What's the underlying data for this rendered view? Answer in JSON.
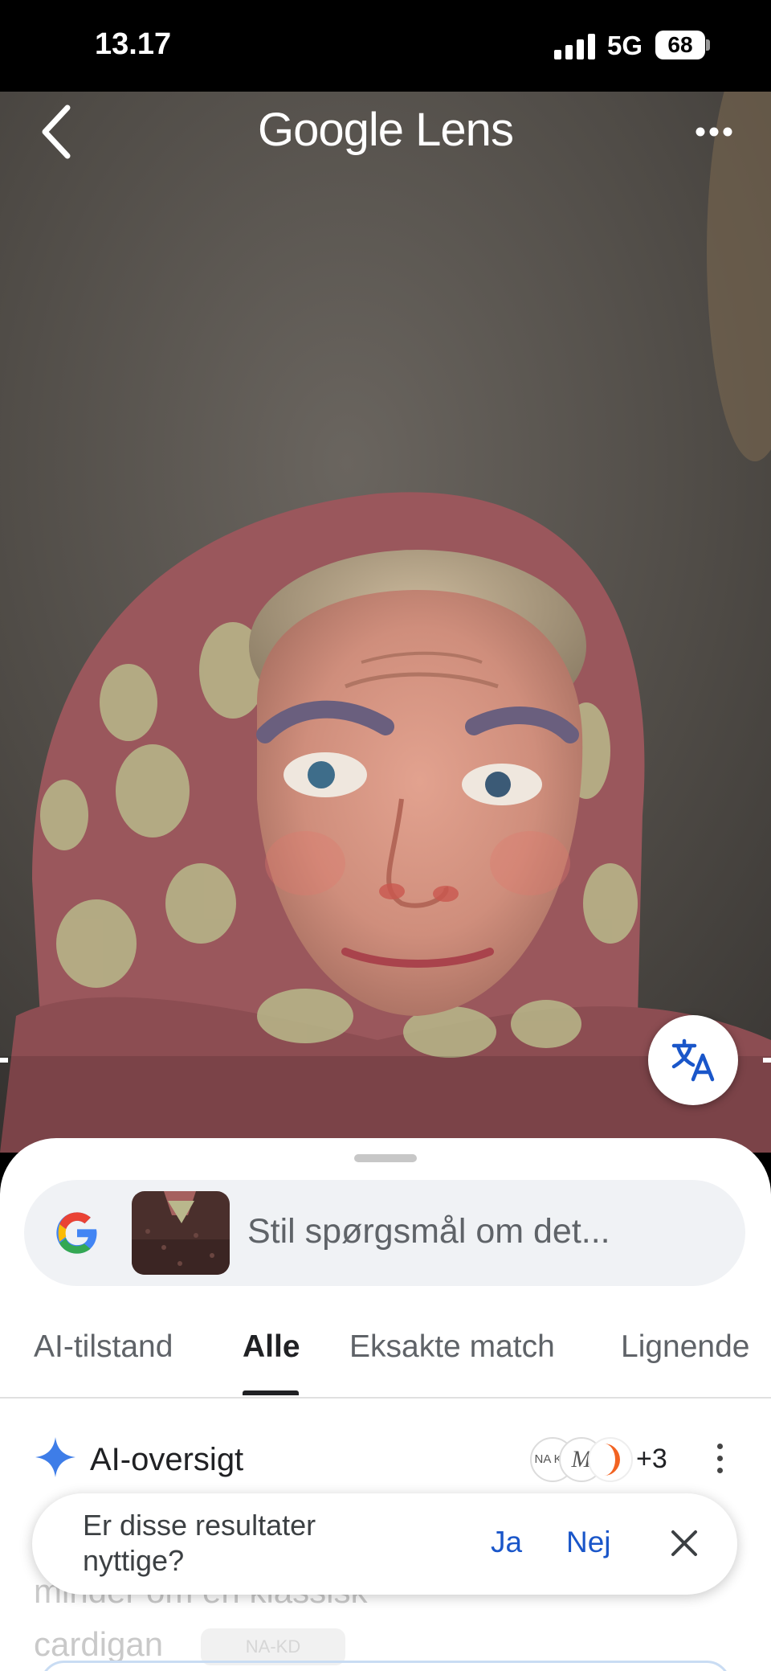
{
  "status_bar": {
    "time": "13.17",
    "network": "5G",
    "battery": "68"
  },
  "header": {
    "title": "Google Lens",
    "back_icon": "chevron-left-icon",
    "more_icon": "more-horizontal-icon"
  },
  "translate_button": {
    "icon": "translate-icon"
  },
  "search": {
    "placeholder": "Stil spørgsmål om det..."
  },
  "tabs": [
    {
      "label": "AI-tilstand"
    },
    {
      "label": "Alle",
      "active": true
    },
    {
      "label": "Eksakte match"
    },
    {
      "label": "Lignende"
    }
  ],
  "ai_overview": {
    "title": "AI-oversigt",
    "sources": [
      "NA KD",
      "M",
      ""
    ],
    "more_sources": "+3",
    "text_line_1": "minder om en klassisk",
    "text_line_2": "cardigan",
    "chip": "NA-KD"
  },
  "feedback": {
    "question": "Er disse resultater nyttige?",
    "yes": "Ja",
    "no": "Nej"
  },
  "colors": {
    "accent_blue": "#1a56c9",
    "sparkle_blue": "#3e7de8",
    "scarf_red": "#9e5a5f",
    "scarf_pattern": "#b7b78a"
  }
}
